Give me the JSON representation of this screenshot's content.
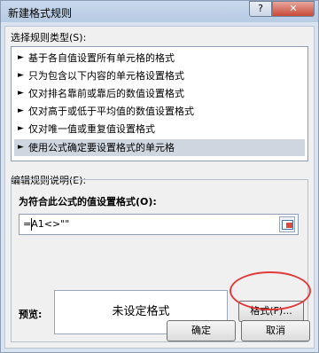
{
  "window": {
    "title": "新建格式规则",
    "help_label": "?",
    "close_label": "✕"
  },
  "rule_type": {
    "label": "选择规则类型(S):",
    "items": [
      {
        "text": "基于各自值设置所有单元格的格式",
        "selected": false
      },
      {
        "text": "只为包含以下内容的单元格设置格式",
        "selected": false
      },
      {
        "text": "仅对排名靠前或靠后的数值设置格式",
        "selected": false
      },
      {
        "text": "仅对高于或低于平均值的数值设置格式",
        "selected": false
      },
      {
        "text": "仅对唯一值或重复值设置格式",
        "selected": false
      },
      {
        "text": "使用公式确定要设置格式的单元格",
        "selected": true
      }
    ],
    "arrow_glyph": "►"
  },
  "edit_rule": {
    "label": "编辑规则说明(E):",
    "formula_label": "为符合此公式的值设置格式(O):",
    "formula_value": "=A1<>\"\"",
    "preview_label": "预览:",
    "preview_text": "未设定格式",
    "format_button": "格式(F)..."
  },
  "buttons": {
    "ok": "确定",
    "cancel": "取消"
  },
  "colors": {
    "highlight": "#e03c3c",
    "selected_row": "#cfd6e0"
  }
}
